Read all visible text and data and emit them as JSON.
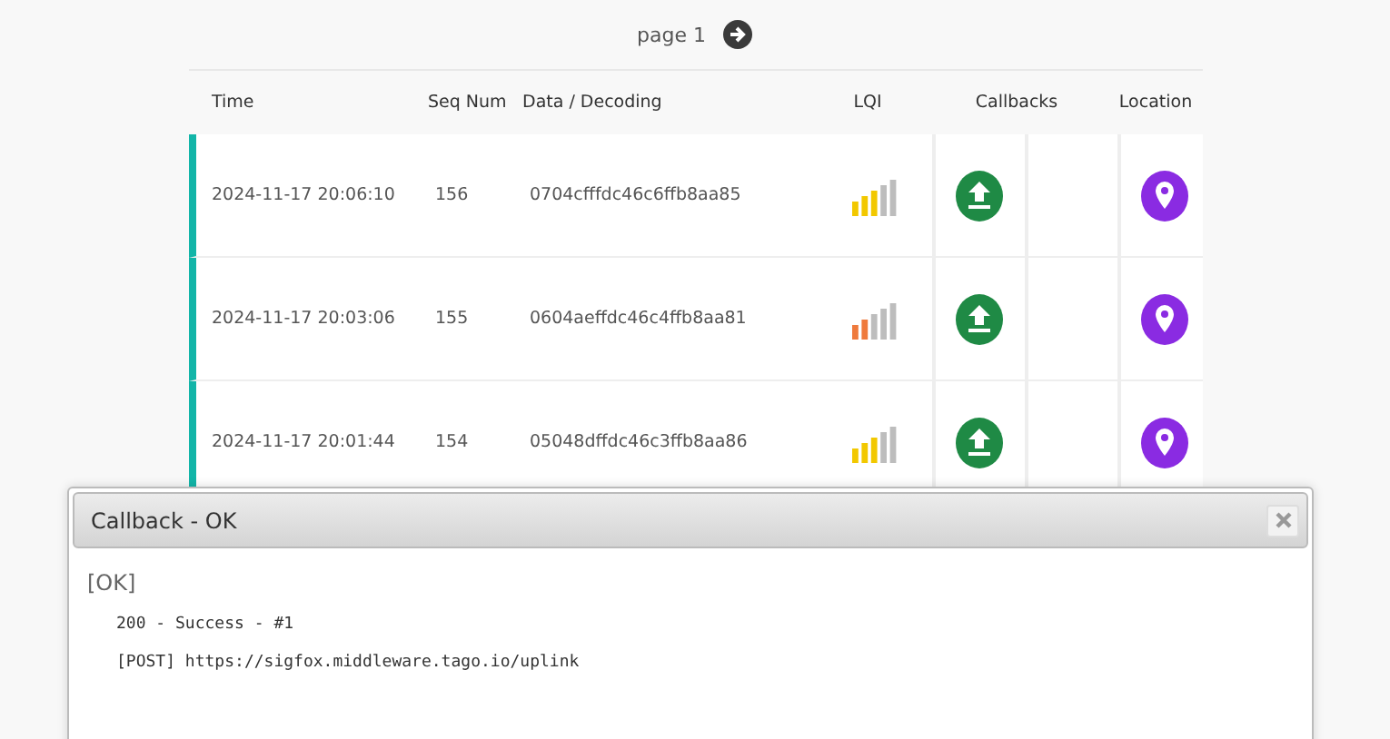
{
  "pager": {
    "label": "page 1"
  },
  "table": {
    "columns": [
      "Time",
      "Seq Num",
      "Data / Decoding",
      "LQI",
      "Callbacks",
      "Location"
    ],
    "rows": [
      {
        "time": "2024-11-17 20:06:10",
        "seq": "156",
        "data": "0704cfffdc46c6ffb8aa85",
        "kind": "good"
      },
      {
        "time": "2024-11-17 20:03:06",
        "seq": "155",
        "data": "0604aeffdc46c4ffb8aa81",
        "kind": "average"
      },
      {
        "time": "2024-11-17 20:01:44",
        "seq": "154",
        "data": "05048dffdc46c3ffb8aa86",
        "kind": "good"
      }
    ]
  },
  "dialog": {
    "title": "Callback - OK",
    "status": "[OK]",
    "lines": [
      "200 - Success - #1",
      "[POST] https://sigfox.middleware.tago.io/uplink"
    ]
  }
}
